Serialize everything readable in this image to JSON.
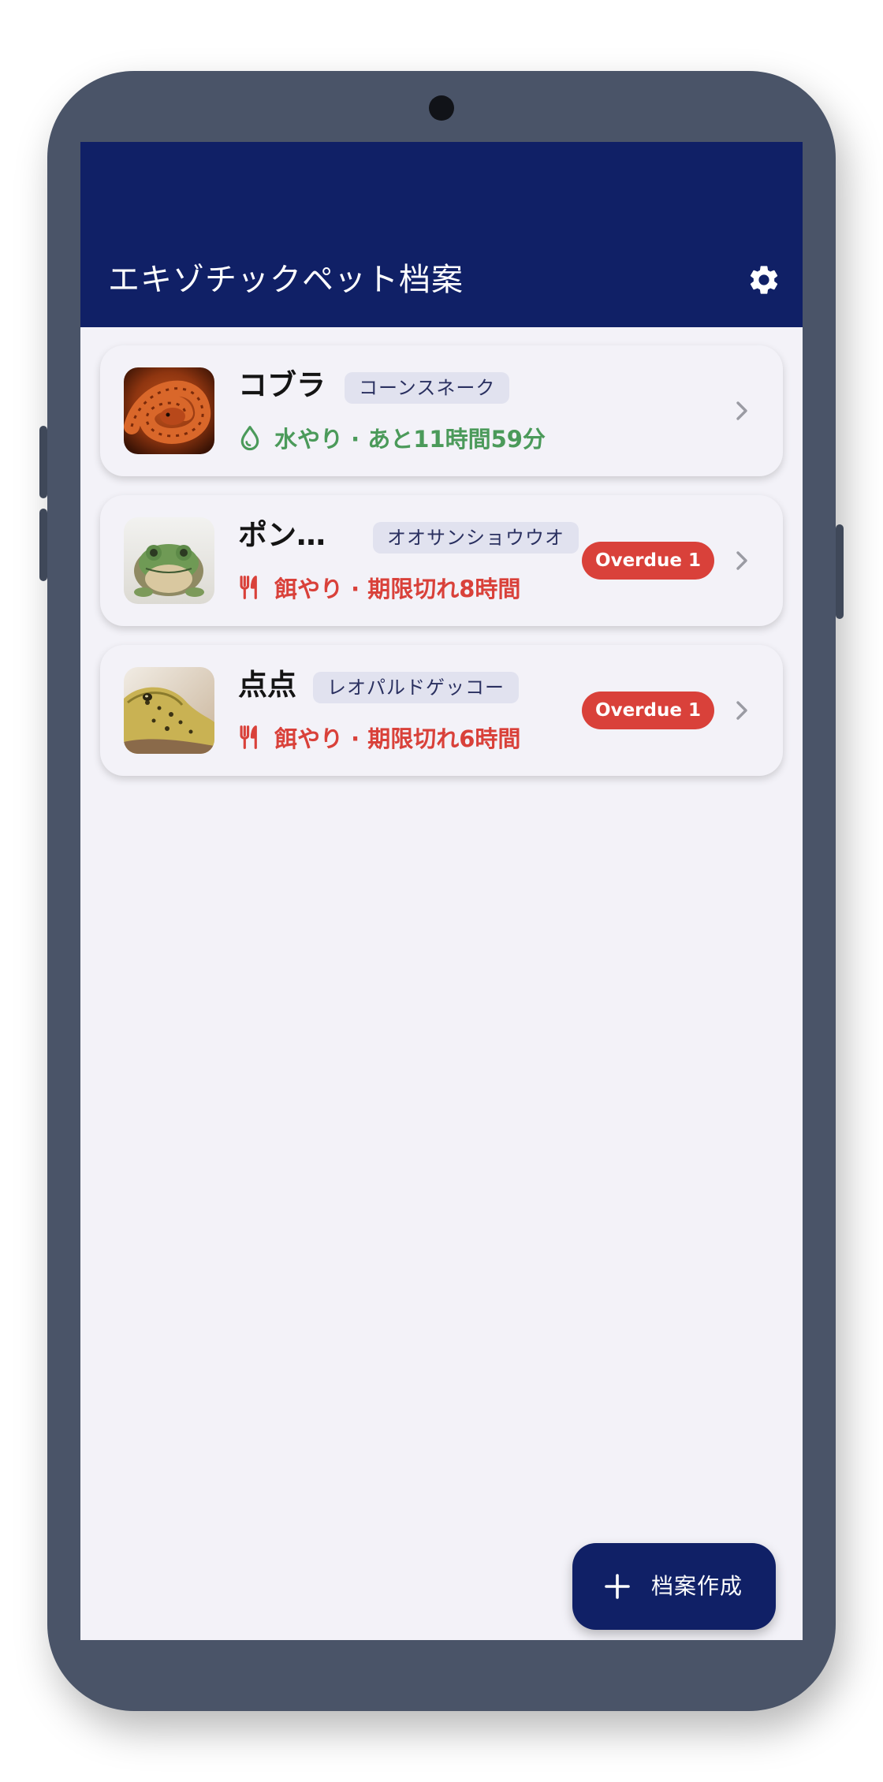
{
  "app": {
    "title": "エキゾチックペット档案",
    "settings_icon": "gear-icon"
  },
  "colors": {
    "appbar": "#102066",
    "ok": "#4b9a5a",
    "overdue": "#d9413a"
  },
  "pets": [
    {
      "name": "コブラ",
      "species": "コーンスネーク",
      "status_text": "水やり · あと11時間59分",
      "status_type": "ok",
      "status_icon": "water-drop-icon",
      "badge": ""
    },
    {
      "name": "ポン…",
      "species": "オオサンショウウオ",
      "status_text": "餌やり · 期限切れ8時間",
      "status_type": "overdue",
      "status_icon": "fork-knife-icon",
      "badge": "Overdue 1"
    },
    {
      "name": "点点",
      "species": "レオパルドゲッコー",
      "status_text": "餌やり · 期限切れ6時間",
      "status_type": "overdue",
      "status_icon": "fork-knife-icon",
      "badge": "Overdue 1"
    }
  ],
  "fab": {
    "label": "档案作成",
    "icon": "plus-icon"
  }
}
